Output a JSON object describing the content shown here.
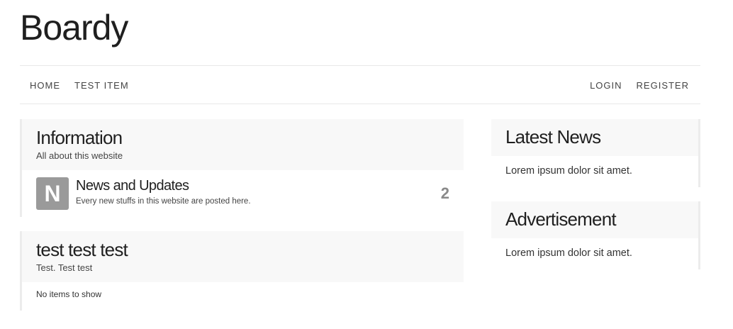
{
  "site": {
    "title": "Boardy"
  },
  "nav": {
    "left": [
      "HOME",
      "TEST ITEM"
    ],
    "right": [
      "LOGIN",
      "REGISTER"
    ]
  },
  "categories": [
    {
      "title": "Information",
      "subtitle": "All about this website",
      "boards": [
        {
          "avatar_letter": "N",
          "name": "News and Updates",
          "description": "Every new stuffs in this website are posted here.",
          "count": "2"
        }
      ]
    },
    {
      "title": "test test test",
      "subtitle": "Test. Test test",
      "empty_message": "No items to show"
    }
  ],
  "sidebar": [
    {
      "title": "Latest News",
      "body": "Lorem ipsum dolor sit amet."
    },
    {
      "title": "Advertisement",
      "body": "Lorem ipsum dolor sit amet."
    }
  ],
  "colors": {
    "avatar_bg": "#9a9a9a",
    "panel_head_bg": "#f8f8f8",
    "border": "#ececec"
  }
}
